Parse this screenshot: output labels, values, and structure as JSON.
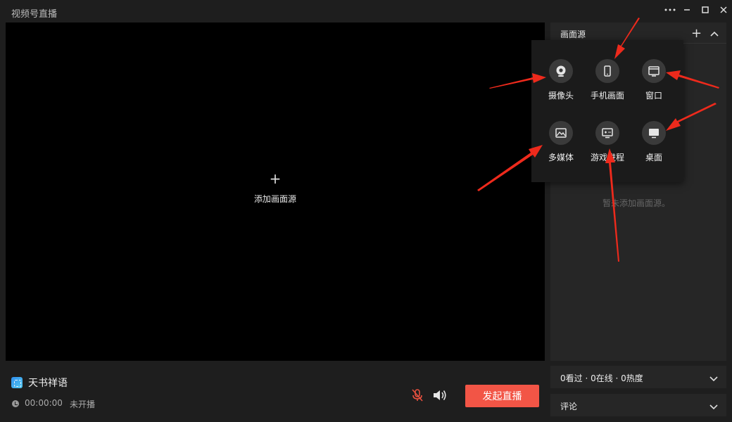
{
  "app": {
    "title": "视频号直播"
  },
  "preview": {
    "add_label": "添加画面源"
  },
  "room": {
    "name": "天书祥语",
    "time": "00:00:00",
    "status": "未开播"
  },
  "controls": {
    "start_label": "发起直播"
  },
  "panel": {
    "title": "画面源",
    "empty": "暂未添加画面源。"
  },
  "stats": {
    "text": "0看过 · 0在线 · 0热度"
  },
  "comments": {
    "label": "评论"
  },
  "source_menu": {
    "items": [
      {
        "label": "摄像头",
        "icon": "camera-icon"
      },
      {
        "label": "手机画面",
        "icon": "phone-icon"
      },
      {
        "label": "窗口",
        "icon": "window-icon"
      },
      {
        "label": "多媒体",
        "icon": "image-icon"
      },
      {
        "label": "游戏进程",
        "icon": "game-icon"
      },
      {
        "label": "桌面",
        "icon": "desktop-icon"
      }
    ]
  },
  "colors": {
    "accent": "#f25546",
    "arrow": "#ee2a1c",
    "panel": "#262626",
    "background": "#1e1e1e"
  }
}
